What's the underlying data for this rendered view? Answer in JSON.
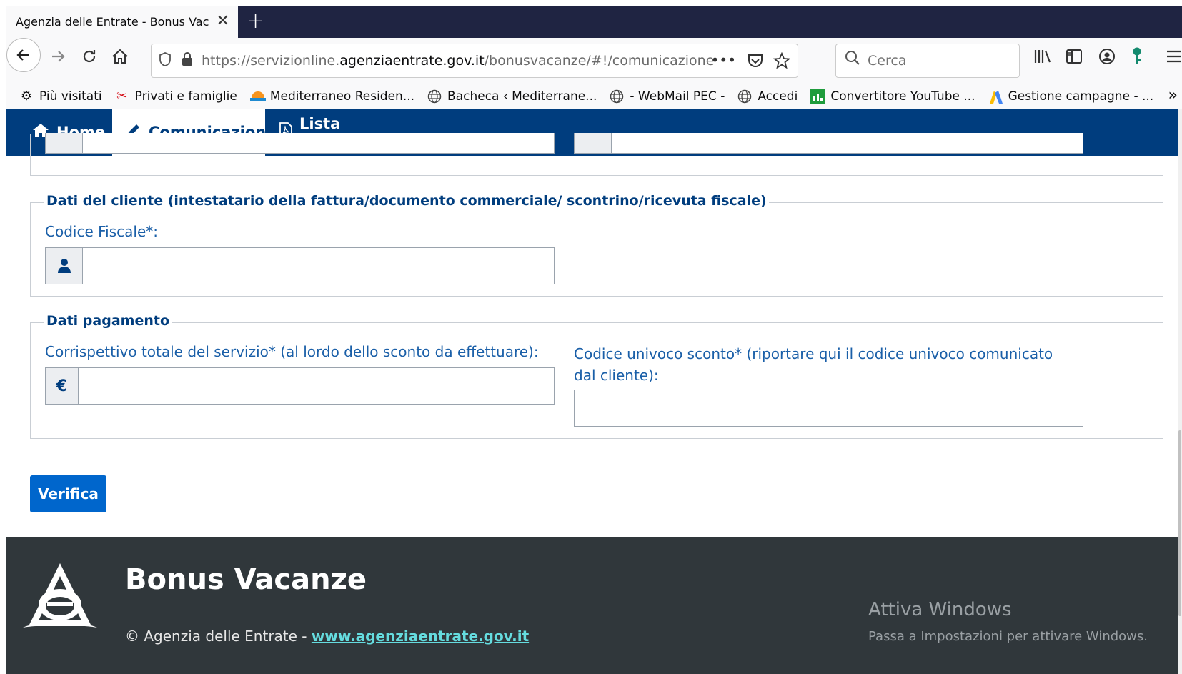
{
  "browser": {
    "tab_title": "Agenzia delle Entrate - Bonus Vacanze",
    "tab_close": "✕",
    "new_tab": "+",
    "url_prefix": "https://servizionline.",
    "url_host": "agenziaentrate.gov.it",
    "url_path": "/bonusvacanze/#!/comunicazione",
    "url_more": "•••",
    "search_placeholder": "Cerca",
    "bookmarks": [
      {
        "label": "Più visitati",
        "icon": "gear-icon"
      },
      {
        "label": "Privati e famiglie",
        "icon": "scissors-icon"
      },
      {
        "label": "Mediterraneo Residen...",
        "icon": "sunset-icon"
      },
      {
        "label": "Bacheca ‹ Mediterrane...",
        "icon": "globe-icon"
      },
      {
        "label": "- WebMail PEC -",
        "icon": "globe-icon"
      },
      {
        "label": "Accedi",
        "icon": "globe-icon"
      },
      {
        "label": "Convertitore YouTube ...",
        "icon": "sheet-icon"
      },
      {
        "label": "Gestione campagne - ...",
        "icon": "ads-icon"
      }
    ],
    "bookmarks_more": "»"
  },
  "nav": {
    "home": "Home",
    "comunicazione": "Comunicazione",
    "lista": "Lista Operazioni"
  },
  "cliente": {
    "legend": "Dati del cliente (intestatario della fattura/documento commerciale/ scontrino/ricevuta fiscale)",
    "cf_label": "Codice Fiscale*:",
    "cf_value": ""
  },
  "pagamento": {
    "legend": "Dati pagamento",
    "corrispettivo_label": "Corrispettivo totale del servizio* (al lordo dello sconto da effettuare):",
    "currency": "€",
    "corrispettivo_value": "",
    "codice_label": "Codice univoco sconto* (riportare qui il codice univoco comunicato dal cliente):",
    "codice_value": ""
  },
  "actions": {
    "verify": "Verifica"
  },
  "footer": {
    "title": "Bonus Vacanze",
    "copyright": "© Agenzia delle Entrate - ",
    "link": "www.agenziaentrate.gov.it"
  },
  "windows_watermark": {
    "title": "Attiva Windows",
    "subtitle": "Passa a Impostazioni per attivare Windows."
  },
  "colors": {
    "primary": "#003d7e",
    "label": "#1a5fa8",
    "button": "#0066cc",
    "footer": "#30373b",
    "footer_link": "#65dcdf"
  }
}
